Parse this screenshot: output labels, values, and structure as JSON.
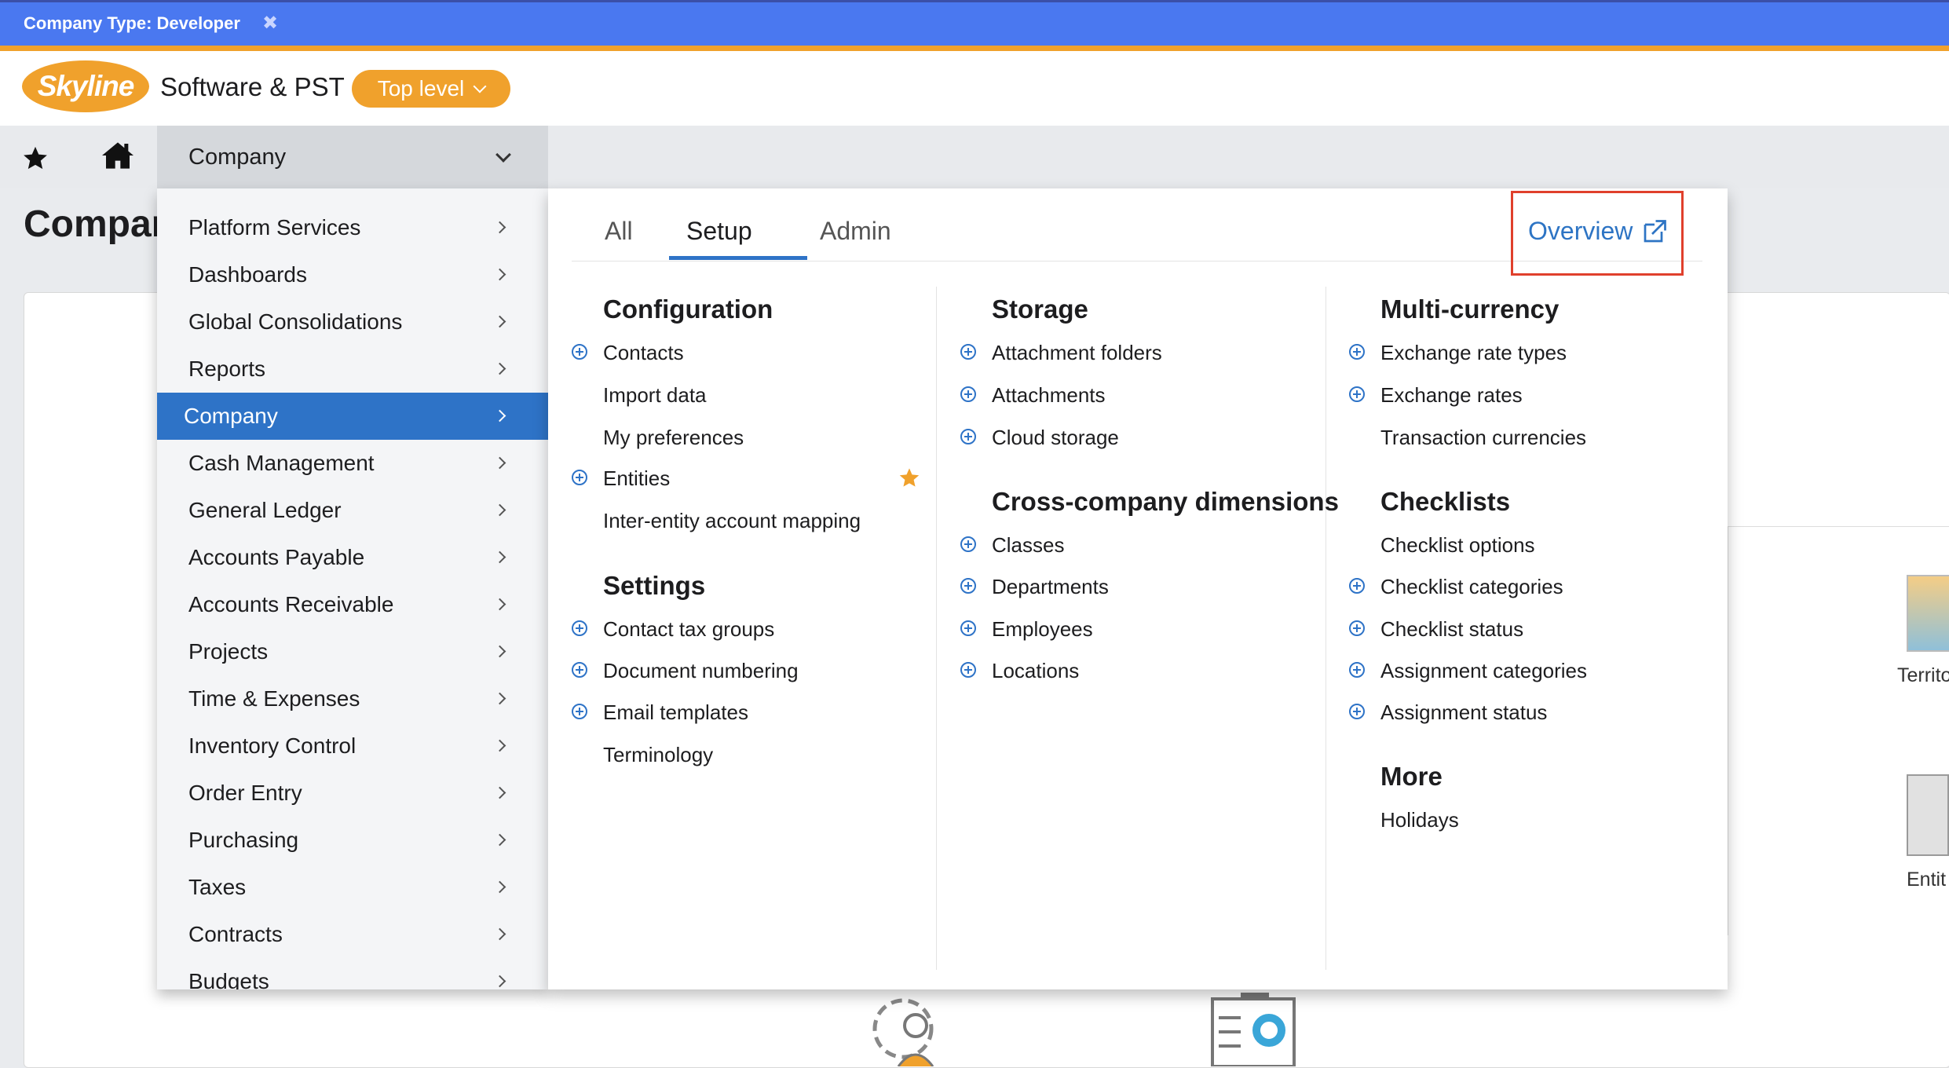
{
  "banner": {
    "text": "Company Type: Developer",
    "close_icon": "close-icon"
  },
  "header": {
    "logo_text": "Skyline",
    "company_name": "Software & PST",
    "level_label": "Top level"
  },
  "nav": {
    "company_label": "Company"
  },
  "page": {
    "title": "Compar",
    "bg_label_1": "Territo",
    "bg_label_2": "Entit"
  },
  "left_menu": {
    "items": [
      {
        "label": "Platform Services"
      },
      {
        "label": "Dashboards"
      },
      {
        "label": "Global Consolidations"
      },
      {
        "label": "Reports"
      },
      {
        "label": "Company",
        "active": true
      },
      {
        "label": "Cash Management"
      },
      {
        "label": "General Ledger"
      },
      {
        "label": "Accounts Payable"
      },
      {
        "label": "Accounts Receivable"
      },
      {
        "label": "Projects"
      },
      {
        "label": "Time & Expenses"
      },
      {
        "label": "Inventory Control"
      },
      {
        "label": "Order Entry"
      },
      {
        "label": "Purchasing"
      },
      {
        "label": "Taxes"
      },
      {
        "label": "Contracts"
      },
      {
        "label": "Budgets"
      }
    ]
  },
  "panel": {
    "tabs": [
      "All",
      "Setup",
      "Admin"
    ],
    "active_tab": "Setup",
    "overview_label": "Overview",
    "columns": {
      "col1": {
        "configuration": {
          "title": "Configuration",
          "items": [
            "Contacts",
            "Import data",
            "My preferences",
            "Entities",
            "Inter-entity account mapping"
          ]
        },
        "settings": {
          "title": "Settings",
          "items": [
            "Contact tax groups",
            "Document numbering",
            "Email templates",
            "Terminology"
          ]
        }
      },
      "col2": {
        "storage": {
          "title": "Storage",
          "items": [
            "Attachment folders",
            "Attachments",
            "Cloud storage"
          ]
        },
        "cross_company": {
          "title": "Cross-company dimensions",
          "items": [
            "Classes",
            "Departments",
            "Employees",
            "Locations"
          ]
        }
      },
      "col3": {
        "multi_currency": {
          "title": "Multi-currency",
          "items": [
            "Exchange rate types",
            "Exchange rates",
            "Transaction currencies"
          ]
        },
        "checklists": {
          "title": "Checklists",
          "items": [
            "Checklist options",
            "Checklist categories",
            "Checklist status",
            "Assignment categories",
            "Assignment status"
          ]
        },
        "more": {
          "title": "More",
          "items": [
            "Holidays"
          ]
        }
      }
    }
  },
  "colors": {
    "accent_blue": "#2e73c7",
    "brand_orange": "#f0a12c",
    "banner_blue": "#4a78f0",
    "highlight_red": "#e0402c",
    "favorite_star": "#f0a12c"
  }
}
